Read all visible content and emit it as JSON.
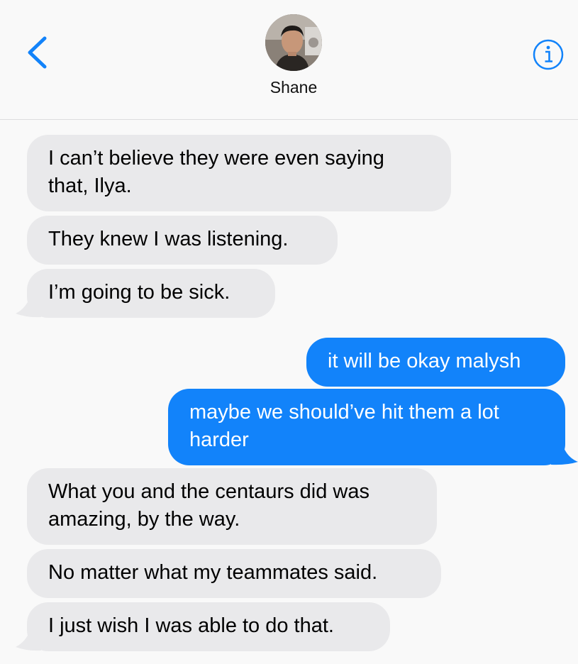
{
  "header": {
    "contact_name": "Shane",
    "back_icon": "chevron-left-icon",
    "info_icon": "info-icon"
  },
  "colors": {
    "incoming_bubble": "#e9e9eb",
    "outgoing_bubble": "#1283fa",
    "accent": "#1283fa",
    "background": "#f9f9f9"
  },
  "messages": [
    {
      "direction": "incoming",
      "text": "I can’t believe they were even saying that, Ilya."
    },
    {
      "direction": "incoming",
      "text": "They knew I was listening."
    },
    {
      "direction": "incoming",
      "text": "I’m going to be sick."
    },
    {
      "direction": "outgoing",
      "text": "it will be okay malysh"
    },
    {
      "direction": "outgoing",
      "text": "maybe we should’ve hit them a lot harder"
    },
    {
      "direction": "incoming",
      "text": "What you and the centaurs did was amazing, by the way."
    },
    {
      "direction": "incoming",
      "text": "No matter what my teammates said."
    },
    {
      "direction": "incoming",
      "text": "I just wish I was able to do that."
    }
  ]
}
